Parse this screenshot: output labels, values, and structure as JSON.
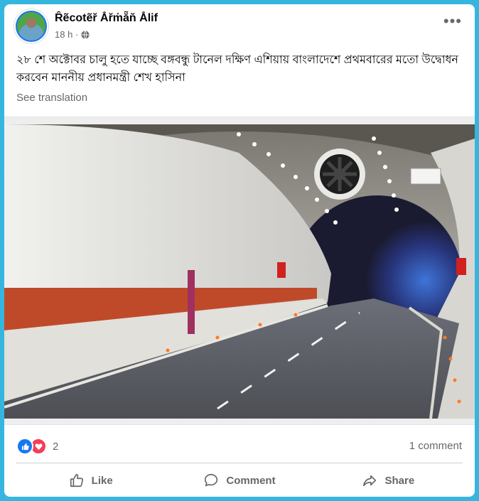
{
  "post": {
    "author": "Ȓẽcotẽř Ẳřṁẵň Ẳlif",
    "time": "18 h ·",
    "privacy_icon": "globe-icon",
    "more_label": "•••",
    "caption": "২৮ শে অক্টোবর চালু হতে যাচ্ছে বঙ্গবন্ধু টানেল দক্ষিণ এশিয়ায় বাংলাদেশে প্রথমবারের মতো উদ্বোধন করবেন মাননীয় প্রধানমন্ত্রী শেখ হাসিনা",
    "see_translation": "See translation"
  },
  "stats": {
    "reaction_icons": [
      "like-icon",
      "love-icon"
    ],
    "reaction_count": "2",
    "comments": "1 comment"
  },
  "actions": {
    "like": "Like",
    "comment": "Comment",
    "share": "Share"
  },
  "colors": {
    "accent": "#1877f2",
    "love": "#f33e58",
    "frame": "#36b6df"
  }
}
